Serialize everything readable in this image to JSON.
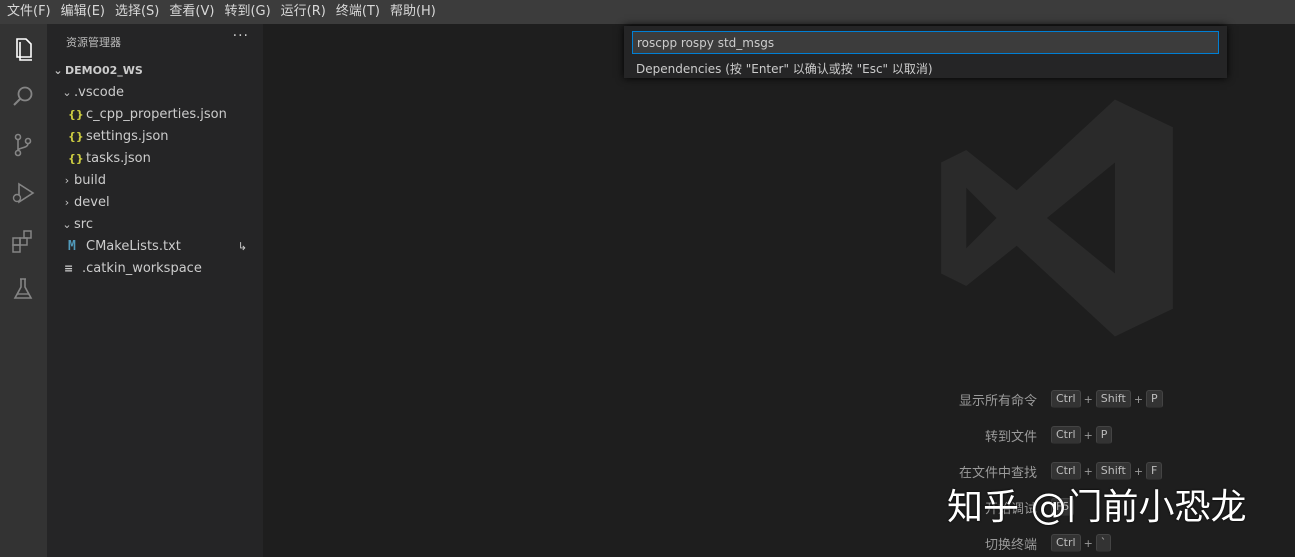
{
  "menu": [
    "文件(F)",
    "编辑(E)",
    "选择(S)",
    "查看(V)",
    "转到(G)",
    "运行(R)",
    "终端(T)",
    "帮助(H)"
  ],
  "activity_icons": [
    "explorer-icon",
    "search-icon",
    "source-control-icon",
    "run-debug-icon",
    "extensions-icon",
    "testing-flask-icon"
  ],
  "sidebar": {
    "title": "资源管理器",
    "more": "···",
    "root": "DEMO02_WS",
    "items": [
      {
        "label": ".vscode",
        "type": "folder",
        "expanded": true,
        "indent": 1
      },
      {
        "label": "c_cpp_properties.json",
        "type": "json",
        "indent": 2
      },
      {
        "label": "settings.json",
        "type": "json",
        "indent": 2
      },
      {
        "label": "tasks.json",
        "type": "json",
        "indent": 2
      },
      {
        "label": "build",
        "type": "folder",
        "expanded": false,
        "indent": 1
      },
      {
        "label": "devel",
        "type": "folder",
        "expanded": false,
        "indent": 1
      },
      {
        "label": "src",
        "type": "folder",
        "expanded": true,
        "indent": 1
      },
      {
        "label": "CMakeLists.txt",
        "type": "cmake",
        "indent": 2,
        "decoration": "↳"
      },
      {
        "label": ".catkin_workspace",
        "type": "lines",
        "indent": 1
      }
    ]
  },
  "quick_input": {
    "value": "roscpp rospy std_msgs",
    "message": "Dependencies (按 \"Enter\" 以确认或按 \"Esc\" 以取消)"
  },
  "shortcuts": [
    {
      "label": "显示所有命令",
      "keys": [
        "Ctrl",
        "Shift",
        "P"
      ]
    },
    {
      "label": "转到文件",
      "keys": [
        "Ctrl",
        "P"
      ]
    },
    {
      "label": "在文件中查找",
      "keys": [
        "Ctrl",
        "Shift",
        "F"
      ]
    },
    {
      "label": "开始调试",
      "keys": [
        "F5"
      ]
    },
    {
      "label": "切换终端",
      "keys": [
        "Ctrl",
        "`"
      ]
    }
  ],
  "watermark": "知乎 @门前小恐龙",
  "colors": {
    "accent": "#007fd4",
    "json": "#cbcb41",
    "cmake": "#519aba"
  }
}
